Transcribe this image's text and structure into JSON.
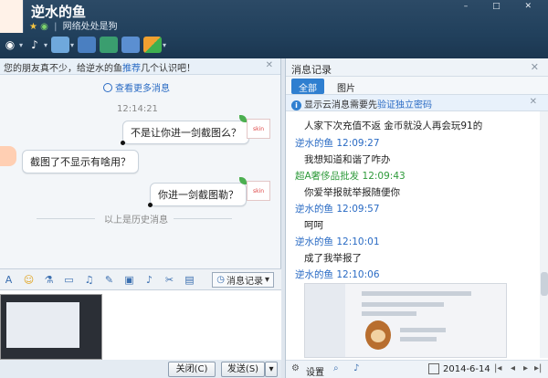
{
  "header": {
    "contact_name": "逆水的鱼",
    "signature": "网络处处是狗",
    "window_controls": "– □ ✕",
    "toolbar_icons": [
      "video-icon",
      "microphone-icon",
      "folder-icon",
      "app-icon",
      "remote-icon",
      "screen-share-icon",
      "apps-grid-icon"
    ]
  },
  "chat": {
    "notice_prefix": "您的朋友真不少，给逆水的鱼",
    "notice_link": "推荐",
    "notice_suffix": "几个认识吧！",
    "more_messages": "查看更多消息",
    "timestamp": "12:14:21",
    "messages": [
      {
        "text": "不是让你进一剑截图么？",
        "side": "right"
      },
      {
        "text": "截图了不显示有啥用？",
        "side": "left"
      },
      {
        "text": "你进一剑截图勒？",
        "side": "right"
      }
    ],
    "sticker_text": "skin",
    "history_divider": "以上是历史消息"
  },
  "input": {
    "message_record": "消息记录",
    "close": "关闭(C)",
    "send": "发送(S)"
  },
  "history": {
    "title": "消息记录",
    "tabs": [
      "全部",
      "图片"
    ],
    "cloud_notice_prefix": "显示云消息需要先",
    "cloud_notice_link": "验证独立密码",
    "records": [
      {
        "type": "text",
        "text": "人家下次充值不返 金币就没人再会玩91的"
      },
      {
        "type": "sender",
        "name": "逆水的鱼",
        "time": "12:09:27"
      },
      {
        "type": "text",
        "text": "我想知道和谐了咋办"
      },
      {
        "type": "sender",
        "name": "超A奢侈品批发",
        "time": "12:09:43",
        "color": "green"
      },
      {
        "type": "text",
        "text": "你爱举报就举报随便你"
      },
      {
        "type": "sender",
        "name": "逆水的鱼",
        "time": "12:09:57"
      },
      {
        "type": "text",
        "text": "呵呵"
      },
      {
        "type": "sender",
        "name": "逆水的鱼",
        "time": "12:10:01"
      },
      {
        "type": "text",
        "text": "成了我举报了"
      },
      {
        "type": "sender",
        "name": "逆水的鱼",
        "time": "12:10:06"
      }
    ],
    "footer": {
      "settings": "设置",
      "date": "2014-6-14"
    }
  }
}
